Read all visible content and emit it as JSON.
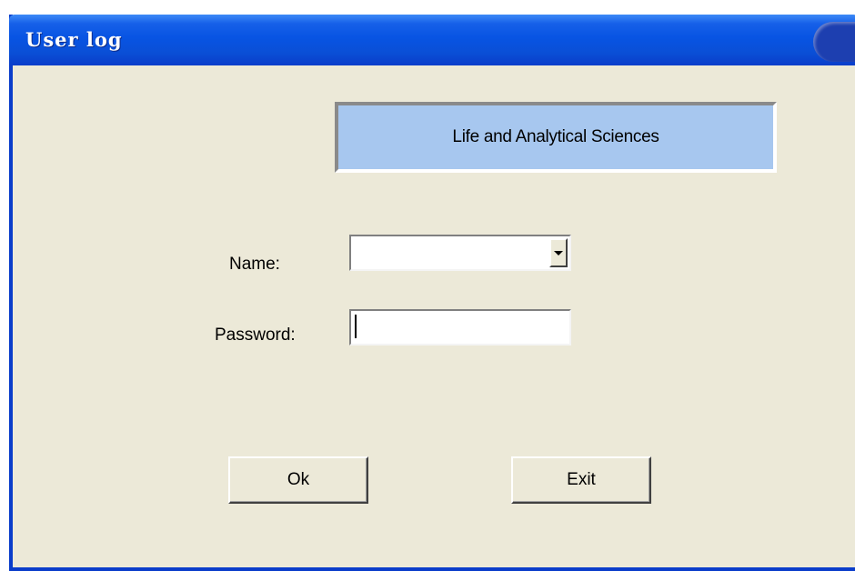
{
  "window": {
    "title": "User log"
  },
  "brand": {
    "text": "Life and Analytical Sciences"
  },
  "form": {
    "name_label": "Name:",
    "name_value": "",
    "password_label": "Password:",
    "password_value": ""
  },
  "buttons": {
    "ok_label": "Ok",
    "exit_label": "Exit"
  },
  "icons": {
    "dropdown": "chevron-down-icon"
  },
  "colors": {
    "titlebar": "#0a4fd6",
    "window_bg": "#ece9d8",
    "brand_bg": "#a7c7ef"
  }
}
